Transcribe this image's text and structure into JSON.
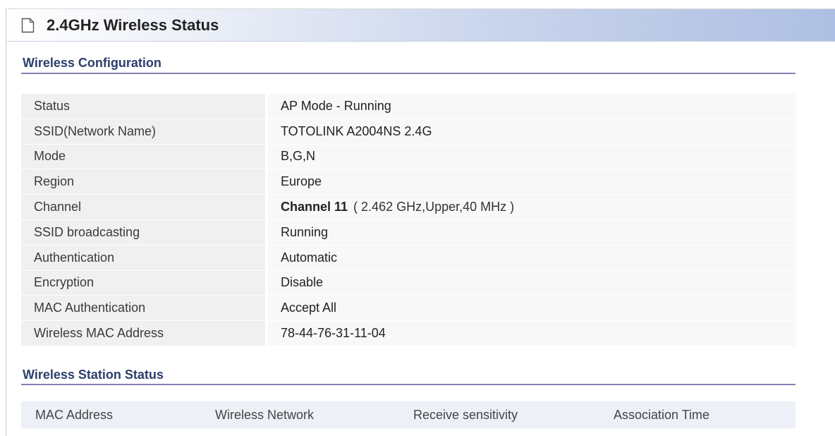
{
  "page": {
    "title": "2.4GHz Wireless Status",
    "title_icon": "page-icon"
  },
  "config": {
    "heading": "Wireless Configuration",
    "rows": [
      {
        "label": "Status",
        "value": "AP Mode - Running"
      },
      {
        "label": "SSID(Network Name)",
        "value": "TOTOLINK A2004NS 2.4G"
      },
      {
        "label": "Mode",
        "value": "B,G,N"
      },
      {
        "label": "Region",
        "value": "Europe"
      },
      {
        "label": "Channel",
        "value_strong": "Channel 11",
        "value_detail": "( 2.462 GHz,Upper,40 MHz )"
      },
      {
        "label": "SSID broadcasting",
        "value": "Running"
      },
      {
        "label": "Authentication",
        "value": "Automatic"
      },
      {
        "label": "Encryption",
        "value": "Disable"
      },
      {
        "label": "MAC Authentication",
        "value": "Accept All"
      },
      {
        "label": "Wireless MAC Address",
        "value": "78-44-76-31-11-04"
      }
    ]
  },
  "stations": {
    "heading": "Wireless Station Status",
    "columns": [
      "MAC Address",
      "Wireless Network",
      "Receive sensitivity",
      "Association Time"
    ]
  },
  "colors": {
    "title_bar_accent": "#aebfe3",
    "section_heading": "#2a3f6b",
    "section_rule": "#8a7fb3"
  }
}
